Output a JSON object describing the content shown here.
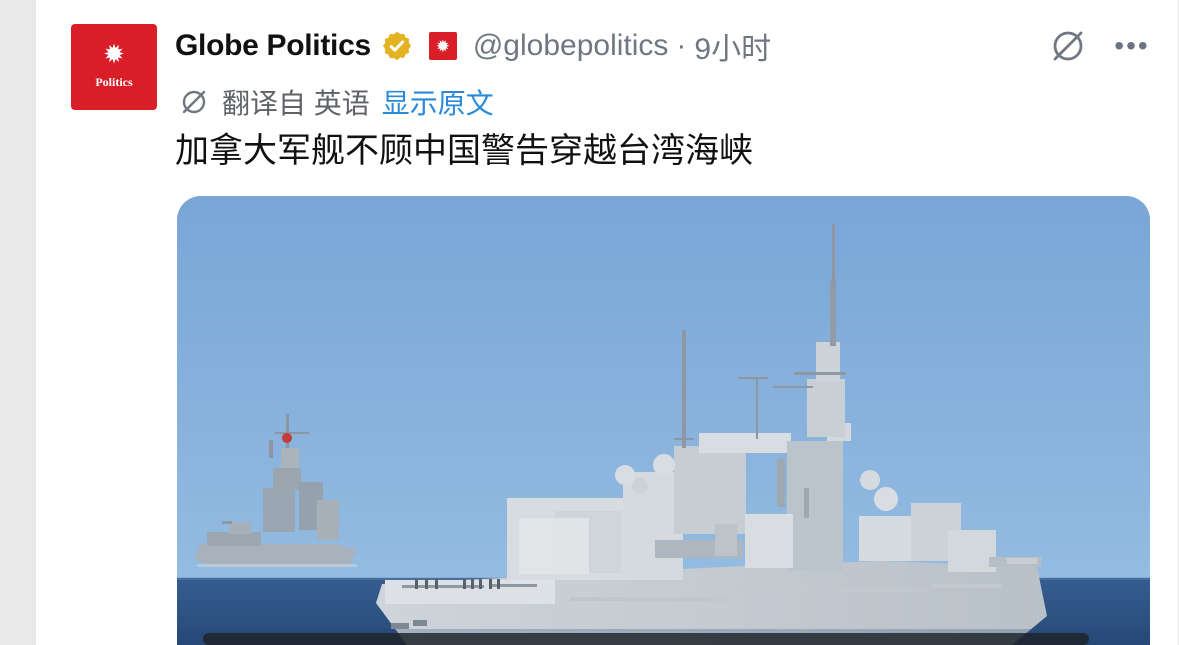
{
  "post": {
    "avatar_label": "Politics",
    "display_name": "Globe Politics",
    "handle": "@globepolitics",
    "separator": "·",
    "time": "9小时",
    "translation_label": "翻译自 英语",
    "show_original": "显示原文",
    "text": "加拿大军舰不顾中国警告穿越台湾海峡"
  },
  "icons": {
    "avatar": "maple-leaf-icon",
    "verified": "verified-badge-icon",
    "flag": "canada-flag-icon",
    "grok": "grok-icon",
    "more": "more-icon",
    "translation": "translation-icon"
  },
  "colors": {
    "brand_red": "#d91e28",
    "verified_gold": "#e4b321",
    "link_blue": "#2a8ad7",
    "secondary_text": "#6f7782"
  }
}
